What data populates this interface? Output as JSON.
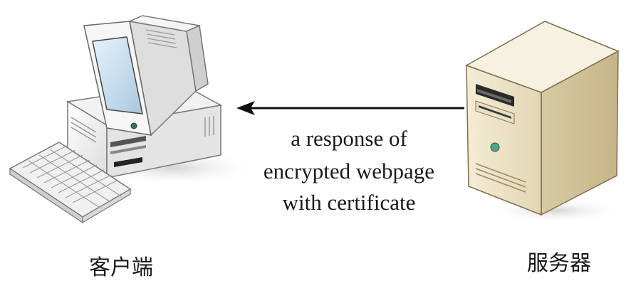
{
  "diagram": {
    "client_label": "客户端",
    "server_label": "服务器",
    "message_lines": [
      "a response of",
      "encrypted webpage",
      "with certificate"
    ],
    "arrow_direction": "server-to-client",
    "icons": {
      "client": "desktop-computer-icon",
      "server": "server-tower-icon"
    }
  }
}
